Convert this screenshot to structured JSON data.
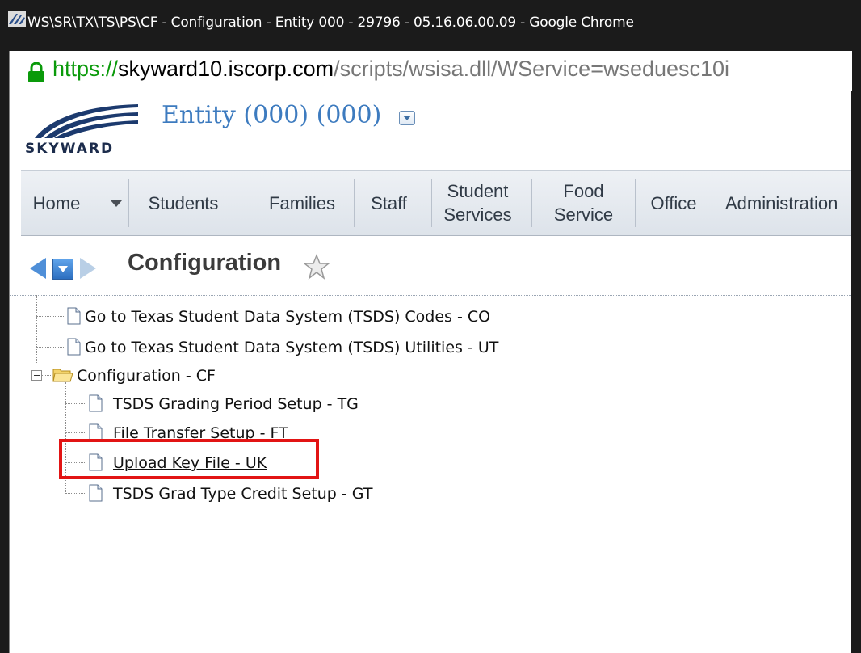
{
  "window": {
    "title": "WS\\SR\\TX\\TS\\PS\\CF - Configuration - Entity 000 - 29796 - 05.16.06.00.09 - Google Chrome",
    "icon": "skyward-app-icon"
  },
  "address_bar": {
    "scheme": "https://",
    "host": "skyward10.iscorp.com",
    "path": "/scripts/wsisa.dll/WService=wseduesc10i",
    "lock_icon": "lock-icon",
    "lock_color": "#0a9a0a"
  },
  "header": {
    "logo_text": "SKYWARD",
    "logo_mark": "®",
    "entity_label": "Entity (000) (000)",
    "accent_color": "#3d7bbf"
  },
  "nav": {
    "items": [
      {
        "label": "Home"
      },
      {
        "label": "Students"
      },
      {
        "label": "Families"
      },
      {
        "label": "Staff"
      },
      {
        "label": "Student\nServices"
      },
      {
        "label": "Food\nService"
      },
      {
        "label": "Office"
      },
      {
        "label": "Administration"
      }
    ]
  },
  "breadcrumb": {
    "title": "Configuration",
    "favorite_icon": "star-icon"
  },
  "tree": {
    "items": [
      {
        "label": "Go to Texas Student Data System (TSDS) Codes - CO",
        "type": "document"
      },
      {
        "label": "Go to Texas Student Data System (TSDS) Utilities - UT",
        "type": "document"
      },
      {
        "label": "Configuration - CF",
        "type": "folder",
        "expanded": true
      },
      {
        "label": "TSDS Grading Period Setup - TG",
        "type": "document"
      },
      {
        "label": "File Transfer Setup - FT",
        "type": "document"
      },
      {
        "label": "Upload Key File - UK",
        "type": "document",
        "highlighted": true
      },
      {
        "label": "TSDS Grad Type Credit Setup - GT",
        "type": "document"
      }
    ]
  },
  "colors": {
    "highlight": "#e21414",
    "titlebar": "#1b1b1b"
  }
}
